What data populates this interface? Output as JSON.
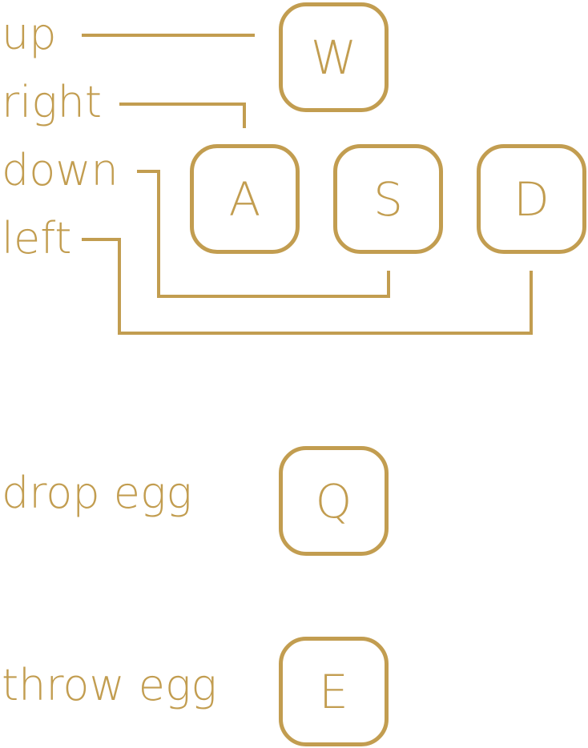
{
  "accent_color": "#c29d50",
  "actions": {
    "up": "up",
    "right": "right",
    "down": "down",
    "left": "left",
    "drop_egg": "drop egg",
    "throw_egg": "throw egg"
  },
  "keys": {
    "w": "W",
    "a": "A",
    "s": "S",
    "d": "D",
    "q": "Q",
    "e": "E"
  }
}
